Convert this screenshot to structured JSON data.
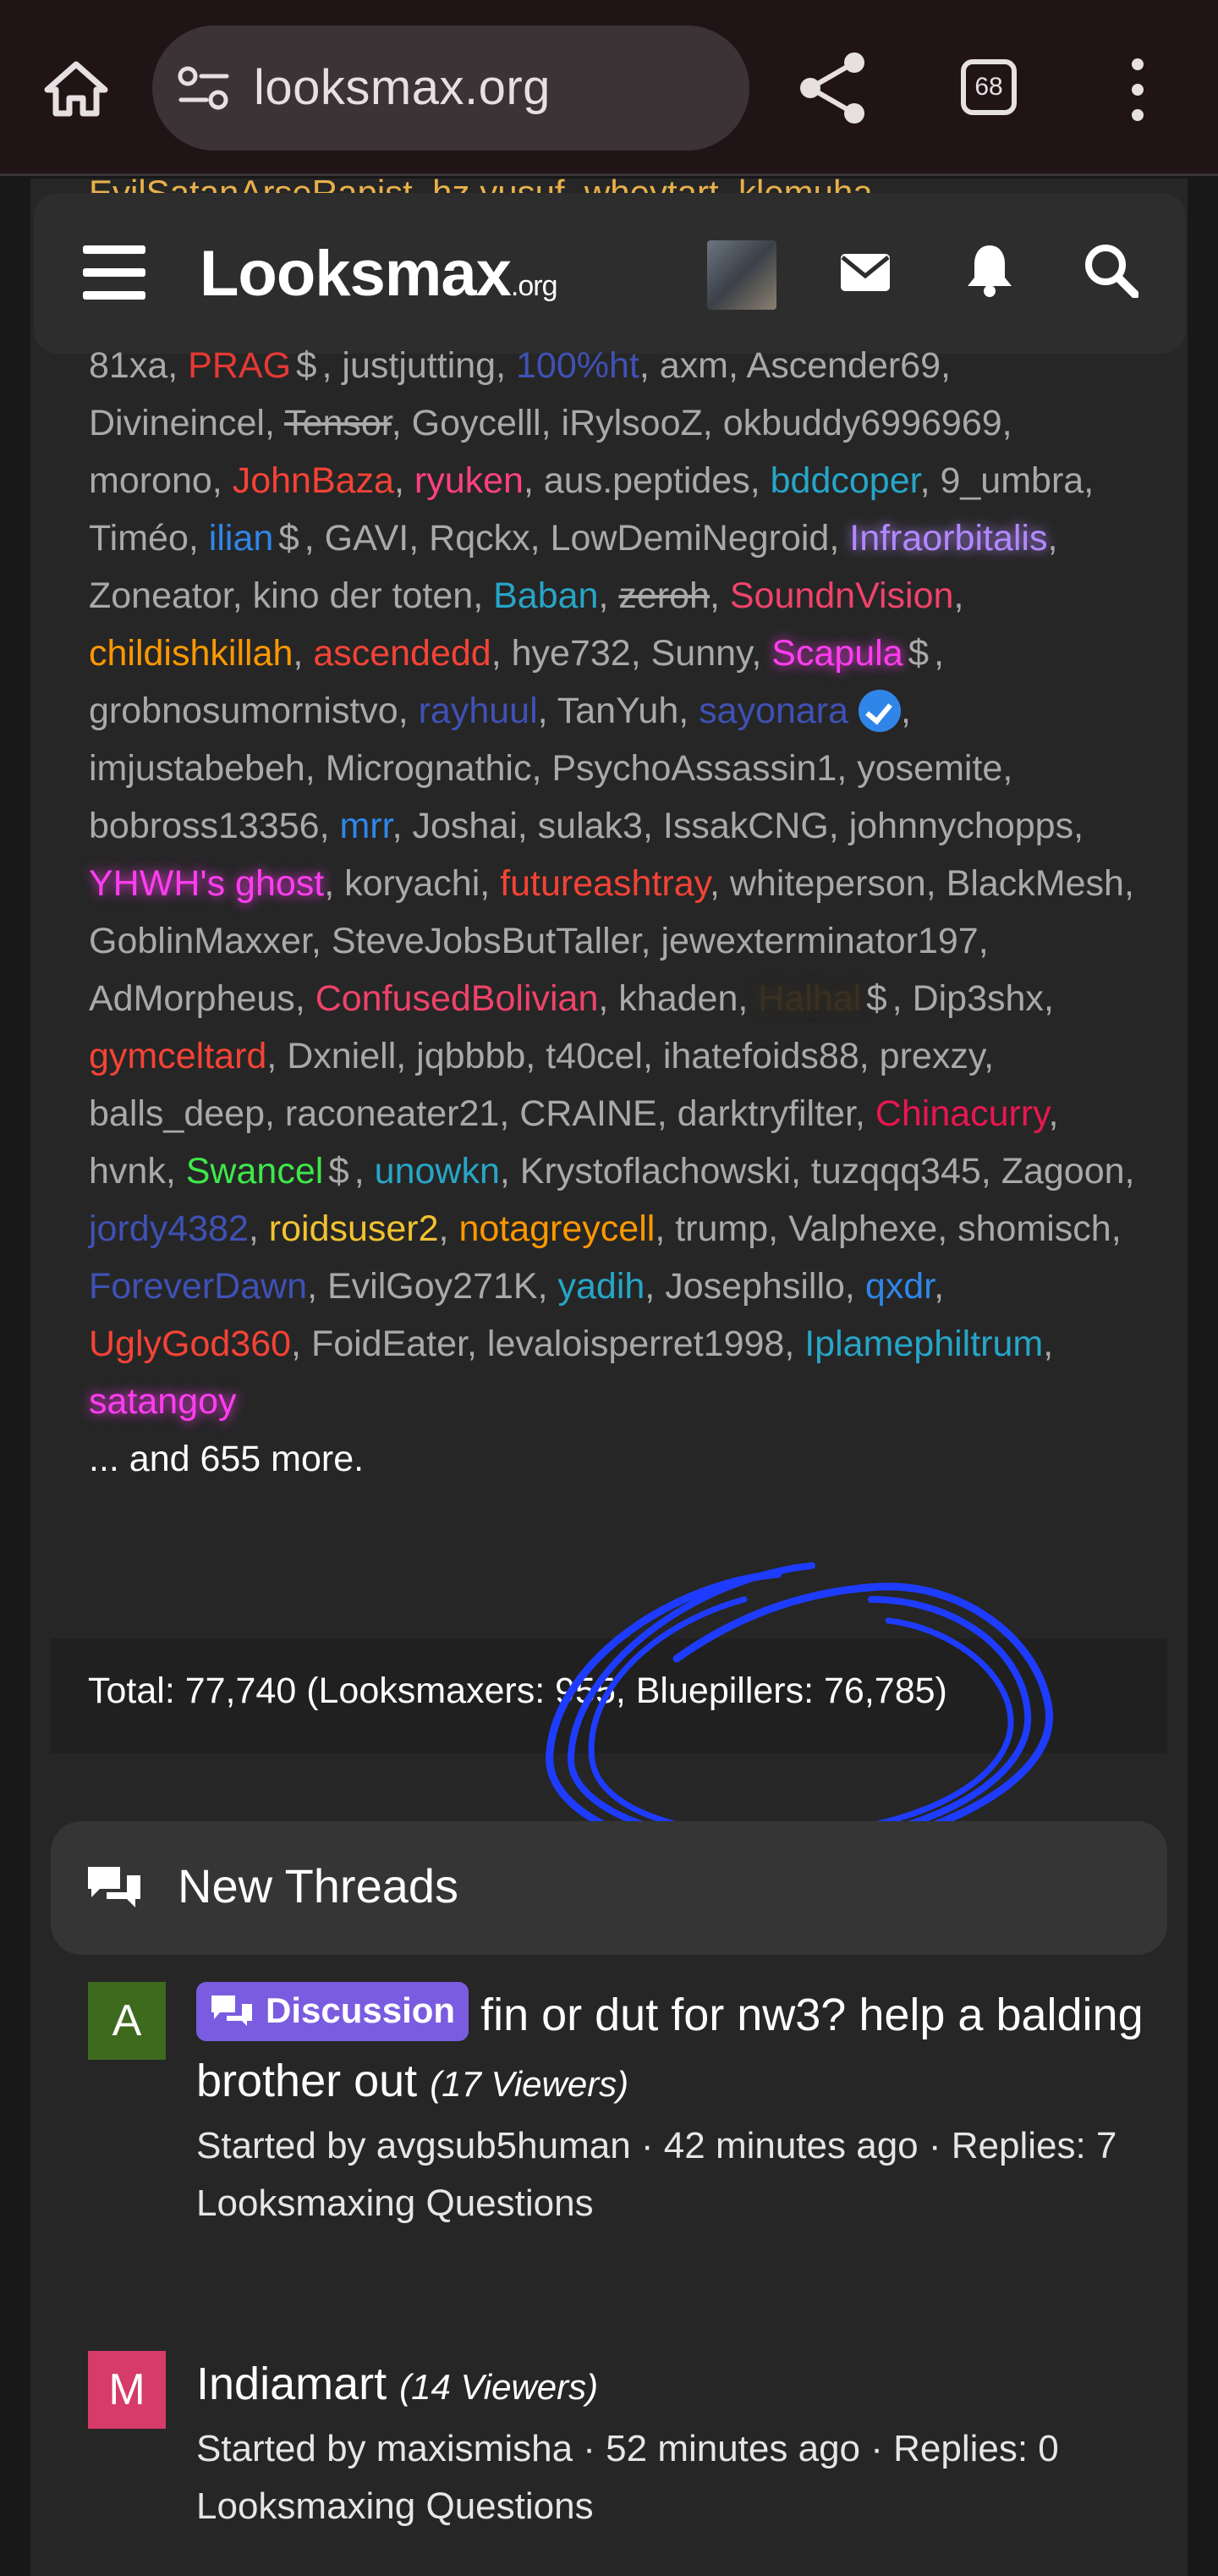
{
  "browser": {
    "url": "looksmax.org",
    "tab_count": "68"
  },
  "site": {
    "logo_text": "Looksmax",
    "logo_suffix": ".org"
  },
  "online": {
    "top_partial_line": "EvilSatanArseRapist, hz yusuf, wheytart, klemuha,",
    "members": [
      {
        "name": "81xa",
        "color": "#a9a9a9"
      },
      {
        "name": "PRAG",
        "color": "#e53935",
        "dollar": true
      },
      {
        "name": "justjutting",
        "color": "#a9a9a9"
      },
      {
        "name": "100%ht",
        "color": "#3f51b5"
      },
      {
        "name": "axm",
        "color": "#a9a9a9"
      },
      {
        "name": "Ascender69",
        "color": "#a9a9a9"
      },
      {
        "name": "Divineincel",
        "color": "#a9a9a9"
      },
      {
        "name": "Tensor",
        "color": "#a9a9a9",
        "strike": true
      },
      {
        "name": "Goycelll",
        "color": "#a9a9a9"
      },
      {
        "name": "iRylsooZ",
        "color": "#a9a9a9"
      },
      {
        "name": "okbuddy6996969",
        "color": "#a9a9a9"
      },
      {
        "name": "morono",
        "color": "#a9a9a9"
      },
      {
        "name": "JohnBaza",
        "color": "#f44336"
      },
      {
        "name": "ryuken",
        "color": "#ff4081"
      },
      {
        "name": "aus.peptides",
        "color": "#a9a9a9"
      },
      {
        "name": "bddcoper",
        "color": "#26a6c8"
      },
      {
        "name": "9_umbra",
        "color": "#a9a9a9"
      },
      {
        "name": "Timéo",
        "color": "#a9a9a9"
      },
      {
        "name": "ilian",
        "color": "#2f86e8",
        "dollar": true
      },
      {
        "name": "GAVI",
        "color": "#a9a9a9"
      },
      {
        "name": "Rqckx",
        "color": "#a9a9a9"
      },
      {
        "name": "LowDemiNegroid",
        "color": "#a9a9a9"
      },
      {
        "name": "Infraorbitalis",
        "color": "#b388ff",
        "glow": true
      },
      {
        "name": "Zoneator",
        "color": "#a9a9a9"
      },
      {
        "name": "kino der toten",
        "color": "#a9a9a9"
      },
      {
        "name": "Baban",
        "color": "#26a6c8"
      },
      {
        "name": "zeroh",
        "color": "#a9a9a9",
        "strike": true
      },
      {
        "name": "SoundnVision",
        "color": "#f0436a"
      },
      {
        "name": "childishkillah",
        "color": "#ff9800"
      },
      {
        "name": "ascendedd",
        "color": "#f44336"
      },
      {
        "name": "hye732",
        "color": "#a9a9a9"
      },
      {
        "name": "Sunny",
        "color": "#a9a9a9"
      },
      {
        "name": "Scapula",
        "color": "#ff3df0",
        "glow": true,
        "dollar": true
      },
      {
        "name": "grobnosumornistvo",
        "color": "#a9a9a9"
      },
      {
        "name": "rayhuul",
        "color": "#3f51b5"
      },
      {
        "name": "TanYuh",
        "color": "#a9a9a9"
      },
      {
        "name": "sayonara",
        "color": "#3f51b5",
        "verified": true
      },
      {
        "name": "imjustabebeh",
        "color": "#a9a9a9"
      },
      {
        "name": "Micrognathic",
        "color": "#a9a9a9"
      },
      {
        "name": "PsychoAssassin1",
        "color": "#a9a9a9"
      },
      {
        "name": "yosemite",
        "color": "#a9a9a9"
      },
      {
        "name": "bobross13356",
        "color": "#a9a9a9"
      },
      {
        "name": "mrr",
        "color": "#2f86e8"
      },
      {
        "name": "Joshai",
        "color": "#a9a9a9"
      },
      {
        "name": "sulak3",
        "color": "#a9a9a9"
      },
      {
        "name": "IssakCNG",
        "color": "#a9a9a9"
      },
      {
        "name": "johnnychopps",
        "color": "#a9a9a9"
      },
      {
        "name": "YHWH's ghost",
        "color": "#ff3df0",
        "glow": true
      },
      {
        "name": "koryachi",
        "color": "#a9a9a9"
      },
      {
        "name": "futureashtray",
        "color": "#f44336"
      },
      {
        "name": "whiteperson",
        "color": "#a9a9a9"
      },
      {
        "name": "BlackMesh",
        "color": "#a9a9a9"
      },
      {
        "name": "GoblinMaxxer",
        "color": "#a9a9a9"
      },
      {
        "name": "SteveJobsButTaller",
        "color": "#a9a9a9"
      },
      {
        "name": "jewexterminator197",
        "color": "#a9a9a9"
      },
      {
        "name": "AdMorpheus",
        "color": "#a9a9a9"
      },
      {
        "name": "ConfusedBolivian",
        "color": "#f0436a"
      },
      {
        "name": "khaden",
        "color": "#a9a9a9"
      },
      {
        "name": "Halhal",
        "color": "#3a3020",
        "glow": true,
        "dollar": true
      },
      {
        "name": "Dip3shx",
        "color": "#a9a9a9"
      },
      {
        "name": "gymceltard",
        "color": "#f44336"
      },
      {
        "name": "Dxniell",
        "color": "#a9a9a9"
      },
      {
        "name": "jqbbbb",
        "color": "#a9a9a9"
      },
      {
        "name": "t40cel",
        "color": "#a9a9a9"
      },
      {
        "name": "ihatefoids88",
        "color": "#a9a9a9"
      },
      {
        "name": "prexzy",
        "color": "#a9a9a9"
      },
      {
        "name": "balls_deep",
        "color": "#a9a9a9"
      },
      {
        "name": "raconeater21",
        "color": "#a9a9a9"
      },
      {
        "name": "CRAINE",
        "color": "#a9a9a9"
      },
      {
        "name": "darktryfilter",
        "color": "#a9a9a9"
      },
      {
        "name": "Chinacurry",
        "color": "#e8174f"
      },
      {
        "name": "hvnk",
        "color": "#a9a9a9"
      },
      {
        "name": "Swancel",
        "color": "#3ee84a",
        "dollar": true
      },
      {
        "name": "unowkn",
        "color": "#26a6c8"
      },
      {
        "name": "Krystoflachowski",
        "color": "#a9a9a9"
      },
      {
        "name": "tuzqqq345",
        "color": "#a9a9a9"
      },
      {
        "name": "Zagoon",
        "color": "#a9a9a9"
      },
      {
        "name": "jordy4382",
        "color": "#3f51b5"
      },
      {
        "name": "roidsuser2",
        "color": "#f2c230"
      },
      {
        "name": "notagreycell",
        "color": "#ff9800"
      },
      {
        "name": "trump",
        "color": "#a9a9a9"
      },
      {
        "name": "Valphexe",
        "color": "#a9a9a9"
      },
      {
        "name": "shomisch",
        "color": "#a9a9a9"
      },
      {
        "name": "ForeverDawn",
        "color": "#3f51b5"
      },
      {
        "name": "EvilGoy271K",
        "color": "#a9a9a9"
      },
      {
        "name": "yadih",
        "color": "#26a6c8"
      },
      {
        "name": "Josephsillo",
        "color": "#a9a9a9"
      },
      {
        "name": "qxdr",
        "color": "#2f86e8"
      },
      {
        "name": "UglyGod360",
        "color": "#f44336"
      },
      {
        "name": "FoidEater",
        "color": "#a9a9a9"
      },
      {
        "name": "levaloisperret1998",
        "color": "#a9a9a9"
      },
      {
        "name": "Iplamephiltrum",
        "color": "#26a6c8"
      },
      {
        "name": "satangoy",
        "color": "#ff3df0",
        "glow": true,
        "last": true
      }
    ],
    "dollar_symbol": "$",
    "more_text": "... and 655 more.",
    "total_text": "Total: 77,740 (Looksmaxers: 955, Bluepillers: 76,785)"
  },
  "new_threads": {
    "title": "New Threads",
    "threads": [
      {
        "avatar_letter": "A",
        "avatar_color": "#3e6a1e",
        "prefix": "Discussion",
        "title": "fin or dut for nw3? help a balding brother out",
        "viewers": "(17 Viewers)",
        "meta": "Started by avgsub5human · 42 minutes ago · Replies: 7",
        "forum": "Looksmaxing Questions"
      },
      {
        "avatar_letter": "M",
        "avatar_color": "#d63b6a",
        "prefix": "",
        "title": "Indiamart",
        "viewers": "(14 Viewers)",
        "meta": "Started by maxismisha · 52 minutes ago · Replies: 0",
        "forum": "Looksmaxing Questions"
      }
    ]
  },
  "colors": {
    "annotation_stroke": "#1e3cff",
    "prefix_bg": "#7a5ce0"
  }
}
